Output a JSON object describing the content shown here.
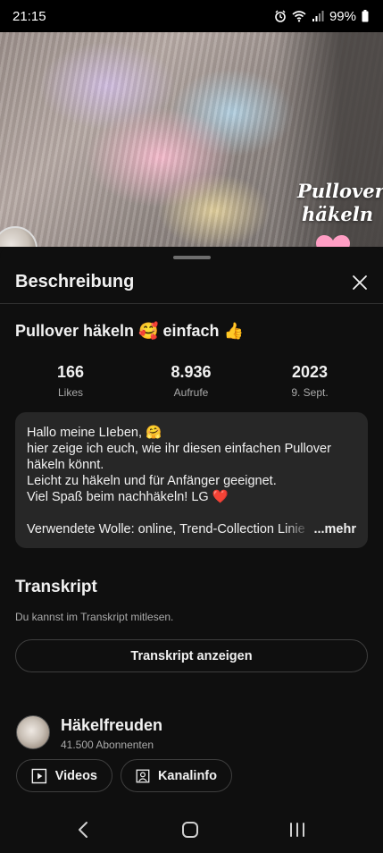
{
  "status": {
    "time": "21:15",
    "battery": "99%"
  },
  "thumbnail": {
    "overlay_text_line1": "Pullover",
    "overlay_text_line2": "häkeln"
  },
  "sheet": {
    "title": "Beschreibung",
    "video_title": "Pullover häkeln 🥰 einfach 👍",
    "stats": [
      {
        "value": "166",
        "label": "Likes"
      },
      {
        "value": "8.936",
        "label": "Aufrufe"
      },
      {
        "value": "2023",
        "label": "9. Sept."
      }
    ],
    "description": {
      "lines": [
        "Hallo meine LIeben, 🤗",
        "hier zeige ich euch, wie ihr diesen einfachen Pullover",
        "häkeln könnt.",
        "Leicht zu häkeln und für Anfänger geeignet.",
        "Viel Spaß beim nachhäkeln! LG ❤️"
      ],
      "last_line": "Verwendete Wolle: online, Trend-Collection Linie",
      "more_label": "...mehr"
    },
    "transcript": {
      "title": "Transkript",
      "subtitle": "Du kannst im Transkript mitlesen.",
      "button_label": "Transkript anzeigen"
    },
    "channel": {
      "name": "Häkelfreuden",
      "subscribers": "41.500 Abonnenten",
      "videos_label": "Videos",
      "info_label": "Kanalinfo"
    }
  },
  "colors": {
    "background": "#0f0f0f",
    "card": "#272727",
    "secondary_text": "#aaaaaa",
    "heart": "#ff9ec4"
  }
}
